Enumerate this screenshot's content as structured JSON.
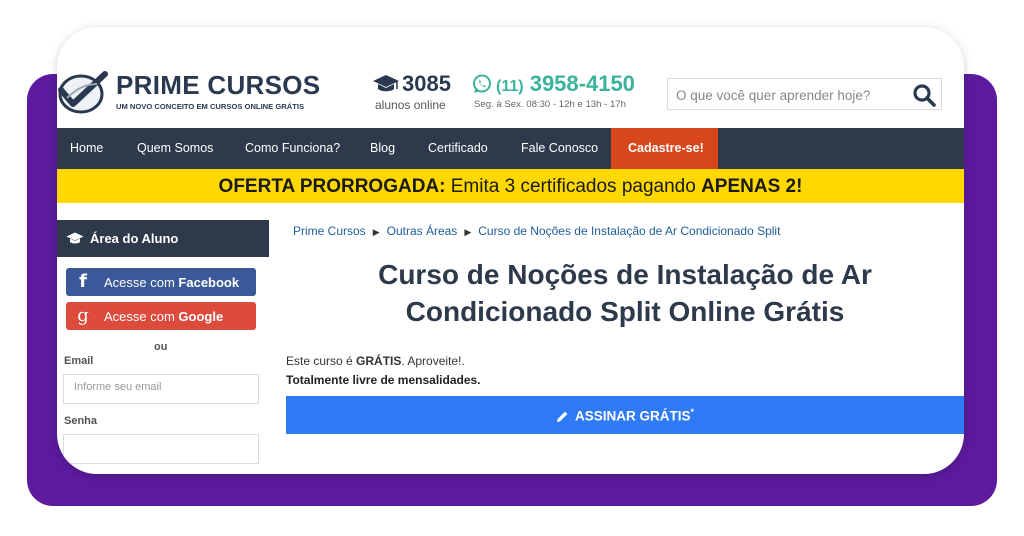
{
  "header": {
    "logo_title": "PRIME CURSOS",
    "logo_tagline": "UM NOVO CONCEITO EM CURSOS ONLINE GRÁTIS",
    "students_count": "3085",
    "students_label": "alunos online",
    "phone_ddd": "(11)",
    "phone_number": "3958-4150",
    "hours": "Seg. à Sex. 08:30 - 12h e 13h - 17h",
    "search_placeholder": "O que você quer aprender hoje?"
  },
  "nav": {
    "items": [
      "Home",
      "Quem Somos",
      "Como Funciona?",
      "Blog",
      "Certificado",
      "Fale Conosco"
    ],
    "cta": "Cadastre-se!"
  },
  "promo": {
    "bold_prefix": "OFERTA PRORROGADA:",
    "text": " Emita 3 certificados pagando ",
    "bold_suffix": "APENAS 2!"
  },
  "sidebar": {
    "title": "Área do Aluno",
    "facebook_prefix": "Acesse com ",
    "facebook_brand": "Facebook",
    "google_prefix": "Acesse com ",
    "google_brand": "Google",
    "or": "ou",
    "email_label": "Email",
    "email_placeholder": "Informe seu email",
    "password_label": "Senha"
  },
  "breadcrumb": [
    "Prime Cursos",
    "Outras Áreas",
    "Curso de Noções de Instalação de Ar Condicionado Split"
  ],
  "main": {
    "title_line1": "Curso de Noções de Instalação de Ar",
    "title_line2": "Condicionado Split Online Grátis",
    "free_prefix": "Este curso é ",
    "free_bold": "GRÁTIS",
    "free_suffix": ". Aproveite!.",
    "no_fees": "Totalmente livre de mensalidades.",
    "subscribe_label": "ASSINAR GRÁTIS",
    "subscribe_mark": "*"
  },
  "colors": {
    "navy": "#2e3a4c",
    "purple_frame": "#5c1b9e",
    "cta_orange": "#d8461b",
    "promo_yellow": "#ffd800",
    "whatsapp_green": "#3bb39b",
    "subscribe_blue": "#2f7bf6",
    "facebook_blue": "#3b5998",
    "google_red": "#dc4b3c"
  },
  "icons": [
    "logo-mark",
    "graduation-cap-icon",
    "whatsapp-icon",
    "search-icon",
    "facebook-icon",
    "google-icon",
    "pencil-icon",
    "caret-right-icon"
  ]
}
